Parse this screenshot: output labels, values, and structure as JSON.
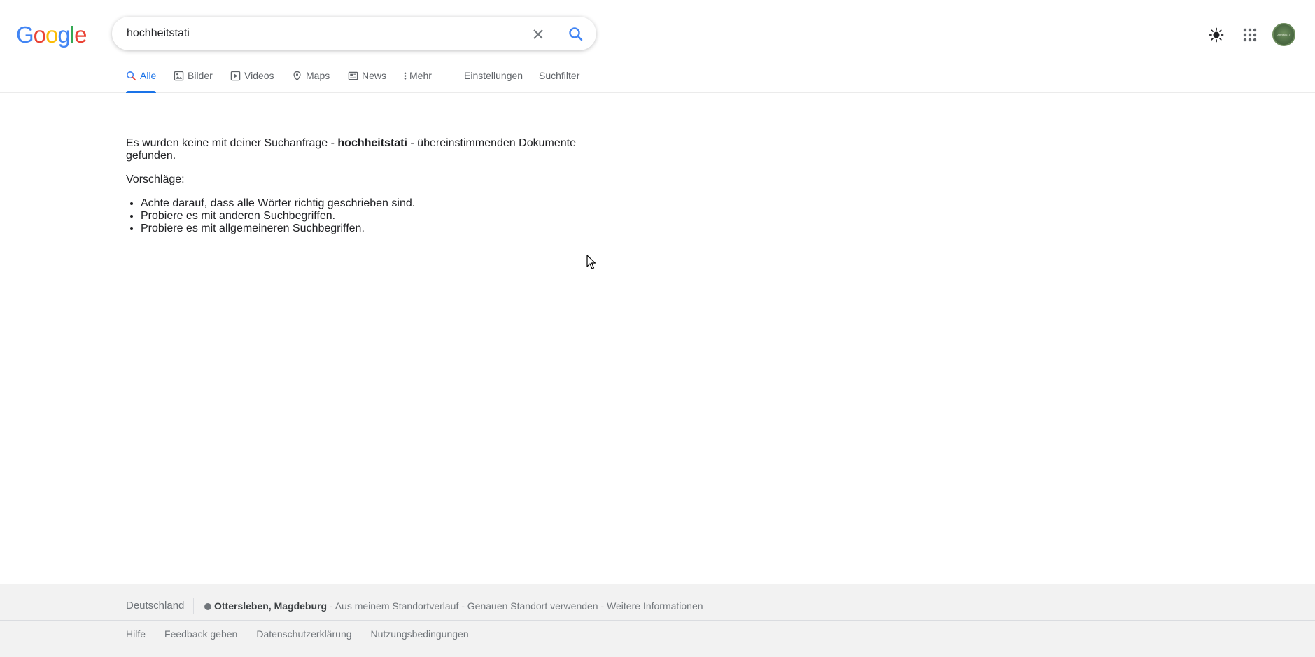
{
  "header": {
    "logo_letters": [
      "G",
      "o",
      "o",
      "g",
      "l",
      "e"
    ],
    "logo_colors": [
      "#4285F4",
      "#EA4335",
      "#FBBC05",
      "#4285F4",
      "#34A853",
      "#EA4335"
    ],
    "query": "hochheitstati",
    "avatar_text": "Anne0017"
  },
  "tabs": {
    "items": [
      {
        "label": "Alle",
        "icon": "search-icon",
        "active": true
      },
      {
        "label": "Bilder",
        "icon": "image-icon"
      },
      {
        "label": "Videos",
        "icon": "video-icon"
      },
      {
        "label": "Maps",
        "icon": "map-pin-icon"
      },
      {
        "label": "News",
        "icon": "news-icon"
      },
      {
        "label": "Mehr",
        "icon": "more-vert-icon"
      }
    ],
    "settings_label": "Einstellungen",
    "filter_label": "Suchfilter"
  },
  "results": {
    "no_results_prefix": "Es wurden keine mit deiner Suchanfrage - ",
    "query_bold": "hochheitstati",
    "no_results_suffix": " - übereinstimmenden Dokumente gefunden.",
    "suggestions_title": "Vorschläge:",
    "suggestions": [
      "Achte darauf, dass alle Wörter richtig geschrieben sind.",
      "Probiere es mit anderen Suchbegriffen.",
      "Probiere es mit allgemeineren Suchbegriffen."
    ]
  },
  "footer": {
    "country": "Deutschland",
    "location": "Ottersleben, Magdeburg",
    "location_source": "Aus meinem Standortverlauf",
    "use_precise": "Genauen Standort verwenden",
    "more_info": "Weitere Informationen",
    "separator": " - ",
    "links": [
      "Hilfe",
      "Feedback geben",
      "Datenschutzerklärung",
      "Nutzungsbedingungen"
    ]
  },
  "colors": {
    "accent": "#1a73e8",
    "muted_text": "#70757a",
    "footer_bg": "#f2f2f2"
  }
}
